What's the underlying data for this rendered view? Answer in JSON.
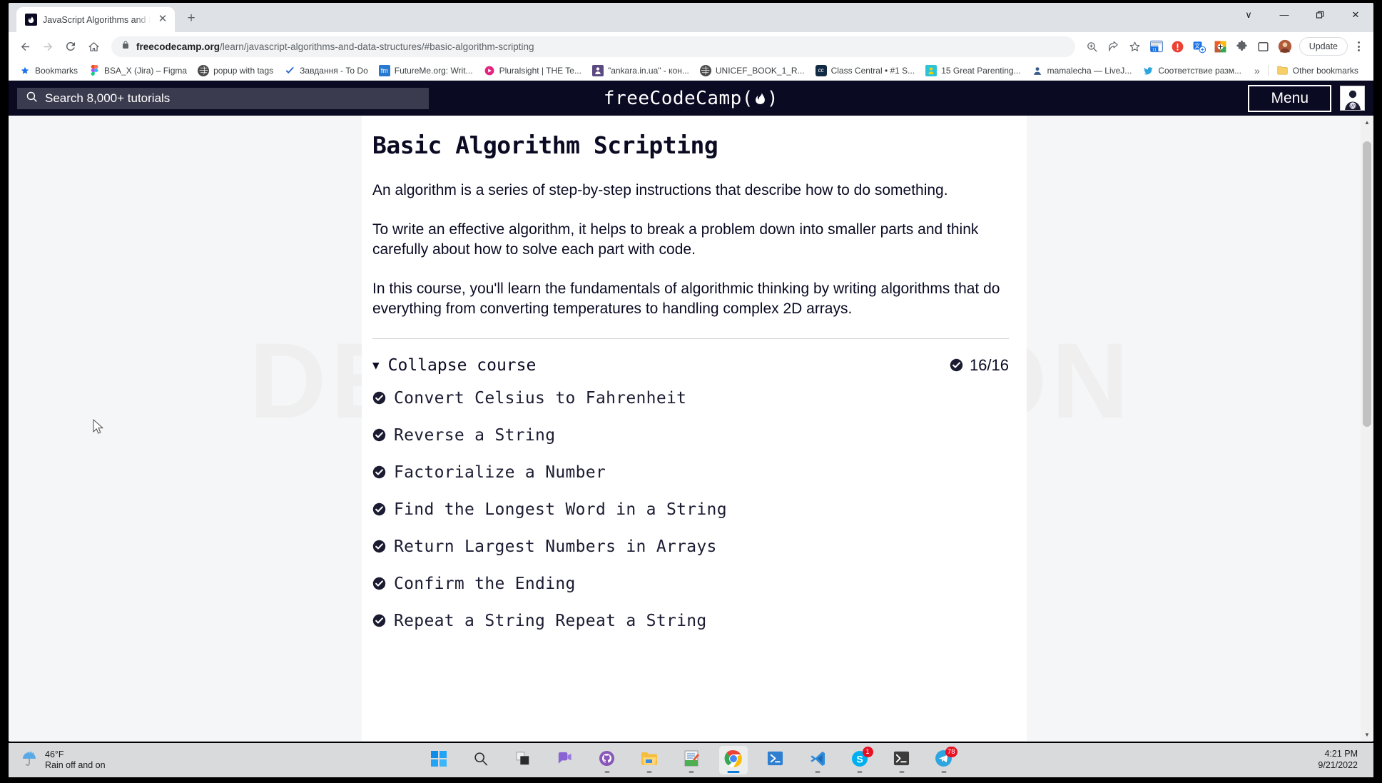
{
  "browser": {
    "tab": {
      "title": "JavaScript Algorithms and Data S",
      "favicon_label": "fcc",
      "close_label": "✕",
      "new_tab_label": "+"
    },
    "window_controls": {
      "more": "∨",
      "minimize": "—",
      "maximize": "❐",
      "close": "✕"
    },
    "nav": {
      "back": "←",
      "forward": "→",
      "reload": "⟳",
      "home": "⌂"
    },
    "omnibox": {
      "url_bold": "freecodecamp.org",
      "url_path": "/learn/javascript-algorithms-and-data-structures/#basic-algorithm-scripting",
      "lock_icon": "lock-icon"
    },
    "toolbar_icons": [
      "zoom-icon",
      "share-icon",
      "bookmark-star-icon",
      "calendar-extension-icon",
      "alert-extension-icon",
      "translate-extension-icon",
      "color-extension-icon",
      "puzzle-extensions-icon",
      "side-panel-icon",
      "profile-avatar-icon"
    ],
    "update_button": "Update",
    "bookmarks": [
      {
        "label": "Bookmarks",
        "icon": "star-icon",
        "color": "#1a73e8"
      },
      {
        "label": "BSA_X (Jira) – Figma",
        "icon": "figma-icon",
        "color": "#f24e1e"
      },
      {
        "label": "popup with tags",
        "icon": "globe-icon",
        "color": "#4a4a4a"
      },
      {
        "label": "Завдання - To Do",
        "icon": "check-icon",
        "color": "#2564cf"
      },
      {
        "label": "FutureMe.org: Writ...",
        "icon": "fm-icon",
        "color": "#2879d0"
      },
      {
        "label": "Pluralsight | THE Te...",
        "icon": "pluralsight-icon",
        "color": "#f15b2a"
      },
      {
        "label": "\"ankara.in.ua\" - кон...",
        "icon": "ankara-icon",
        "color": "#5b4a82"
      },
      {
        "label": "UNICEF_BOOK_1_R...",
        "icon": "globe-icon",
        "color": "#4a4a4a"
      },
      {
        "label": "Class Central • #1 S...",
        "icon": "cc-icon",
        "color": "#122b45"
      },
      {
        "label": "15 Great Parenting...",
        "icon": "parenting-icon",
        "color": "#2ec4d8"
      },
      {
        "label": "mamalecha — LiveJ...",
        "icon": "livejournal-icon",
        "color": "#3b5a8c"
      },
      {
        "label": "Соответствие разм...",
        "icon": "bluebird-icon",
        "color": "#2aa5e0"
      }
    ],
    "bookmarks_overflow": "»",
    "other_bookmarks": {
      "label": "Other bookmarks",
      "icon": "folder-icon"
    }
  },
  "site": {
    "search": {
      "placeholder": "Search 8,000+ tutorials",
      "icon": "search-icon"
    },
    "logo_text": "freeCodeCamp(",
    "logo_suffix": ")",
    "menu_button": "Menu",
    "avatar": "user-avatar-icon"
  },
  "page": {
    "watermark": "DEMO VERSION",
    "title": "Basic Algorithm Scripting",
    "paragraphs": [
      "An algorithm is a series of step-by-step instructions that describe how to do something.",
      "To write an effective algorithm, it helps to break a problem down into smaller parts and think carefully about how to solve each part with code.",
      "In this course, you'll learn the fundamentals of algorithmic thinking by writing algorithms that do everything from converting temperatures to handling complex 2D arrays."
    ],
    "collapse": {
      "caret": "▼",
      "label": "Collapse course",
      "progress": "16/16",
      "progress_icon": "check-circle-icon"
    },
    "challenges": [
      "Convert Celsius to Fahrenheit",
      "Reverse a String",
      "Factorialize a Number",
      "Find the Longest Word in a String",
      "Return Largest Numbers in Arrays",
      "Confirm the Ending",
      "Repeat a String Repeat a String"
    ],
    "scrollbar": {
      "up": "▲",
      "down": "▼"
    }
  },
  "taskbar": {
    "weather": {
      "temp": "46°F",
      "desc": "Rain off and on",
      "icon": "rain-umbrella-icon"
    },
    "apps": [
      {
        "name": "start-button",
        "icon": "windows-logo-icon",
        "badge": "",
        "active": false
      },
      {
        "name": "search-taskbar",
        "icon": "search-icon",
        "badge": "",
        "active": false
      },
      {
        "name": "task-view",
        "icon": "task-view-icon",
        "badge": "",
        "active": false
      },
      {
        "name": "chat",
        "icon": "chat-icon",
        "badge": "",
        "active": false
      },
      {
        "name": "github-desktop",
        "icon": "github-icon",
        "badge": "",
        "active": false
      },
      {
        "name": "file-explorer",
        "icon": "folder-icon",
        "badge": "",
        "active": false
      },
      {
        "name": "notepad",
        "icon": "notepad-icon",
        "badge": "",
        "active": false
      },
      {
        "name": "google-chrome",
        "icon": "chrome-icon",
        "badge": "",
        "active": true
      },
      {
        "name": "powershell",
        "icon": "powershell-icon",
        "badge": "",
        "active": false
      },
      {
        "name": "vs-code",
        "icon": "vscode-icon",
        "badge": "",
        "active": false
      },
      {
        "name": "skype",
        "icon": "skype-icon",
        "badge": "1",
        "active": false
      },
      {
        "name": "terminal",
        "icon": "terminal-icon",
        "badge": "",
        "active": false
      },
      {
        "name": "telegram",
        "icon": "telegram-icon",
        "badge": "78",
        "active": false
      }
    ],
    "clock": {
      "time": "4:21 PM",
      "date": "9/21/2022"
    }
  }
}
